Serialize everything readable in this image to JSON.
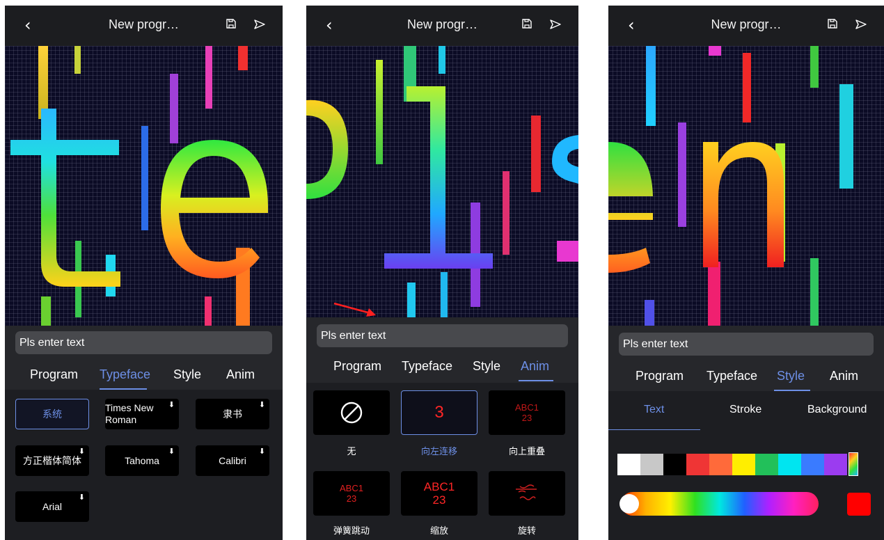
{
  "header": {
    "title": "New progr…",
    "back_icon": "chevron-left-icon",
    "save_icon": "save-icon",
    "send_icon": "send-icon"
  },
  "input": {
    "placeholder": "Pls enter text"
  },
  "tabs": [
    "Program",
    "Typeface",
    "Style",
    "Anim"
  ],
  "screens": [
    {
      "active_tab": "Typeface",
      "preview_text": "te"
    },
    {
      "active_tab": "Anim",
      "preview_text": "o1s"
    },
    {
      "active_tab": "Style",
      "preview_text": "en"
    }
  ],
  "typefaces": [
    {
      "label": "系统",
      "selected": true,
      "downloadable": false
    },
    {
      "label": "Times New Roman",
      "selected": false,
      "downloadable": true
    },
    {
      "label": "隶书",
      "selected": false,
      "downloadable": true
    },
    {
      "label": "方正楷体简体",
      "selected": false,
      "downloadable": true
    },
    {
      "label": "Tahoma",
      "selected": false,
      "downloadable": true
    },
    {
      "label": "Calibri",
      "selected": false,
      "downloadable": true
    },
    {
      "label": "Arial",
      "selected": false,
      "downloadable": true
    }
  ],
  "animations": [
    {
      "label": "无",
      "preview": "",
      "selected": false
    },
    {
      "label": "向左连移",
      "preview": "3",
      "selected": true
    },
    {
      "label": "向上重叠",
      "preview": "ABC1 23",
      "selected": false
    },
    {
      "label": "弹簧跳动",
      "preview": "ABC1 23",
      "selected": false
    },
    {
      "label": "缩放",
      "preview": "ABC1 23",
      "selected": false
    },
    {
      "label": "旋转",
      "preview": "",
      "selected": false
    }
  ],
  "style": {
    "subtabs": [
      "Text",
      "Stroke",
      "Background"
    ],
    "active_subtab": "Text",
    "swatches": [
      "#ffffff",
      "#c8c8c8",
      "#000000",
      "#ef3535",
      "#ff6a3a",
      "#ffee00",
      "#22c05a",
      "#00e5f0",
      "#3a7bff",
      "#9b3cf0"
    ],
    "selected_color": "#ff0000"
  }
}
